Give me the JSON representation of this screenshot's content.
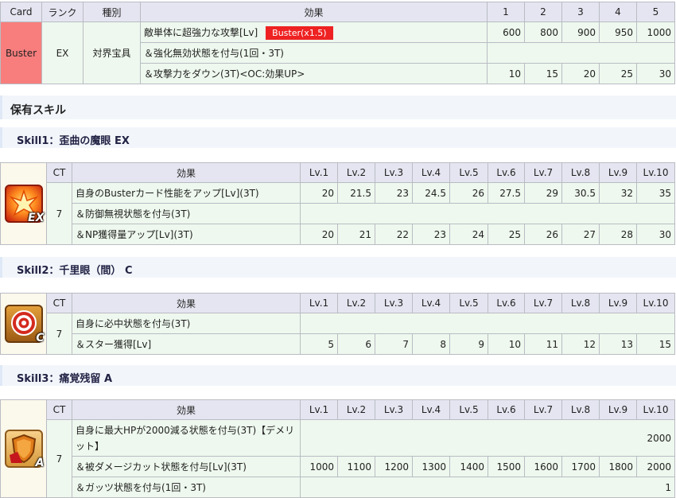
{
  "np": {
    "headers": [
      "Card",
      "ランク",
      "種別",
      "効果",
      "1",
      "2",
      "3",
      "4",
      "5"
    ],
    "card": "Buster",
    "rank": "EX",
    "type": "対界宝具",
    "rows": [
      {
        "effect": "敵単体に超強力な攻撃[Lv]",
        "tag": "Buster(x1.5)",
        "values": [
          "600",
          "800",
          "900",
          "950",
          "1000"
        ]
      },
      {
        "effect": "＆強化無効状態を付与(1回・3T)",
        "values": []
      },
      {
        "effect": "＆攻撃力をダウン(3T)<OC:効果UP>",
        "values": [
          "10",
          "15",
          "20",
          "25",
          "30"
        ]
      }
    ]
  },
  "section_title": "保有スキル",
  "level_headers": [
    "CT",
    "効果",
    "Lv.1",
    "Lv.2",
    "Lv.3",
    "Lv.4",
    "Lv.5",
    "Lv.6",
    "Lv.7",
    "Lv.8",
    "Lv.9",
    "Lv.10"
  ],
  "skills": [
    {
      "title": "Skill1：歪曲の魔眼 EX",
      "icon": "buster-up-icon",
      "rank_label": "EX",
      "ct": "7",
      "rows": [
        {
          "effect": "自身のBusterカード性能をアップ[Lv](3T)",
          "values": [
            "20",
            "21.5",
            "23",
            "24.5",
            "26",
            "27.5",
            "29",
            "30.5",
            "32",
            "35"
          ]
        },
        {
          "effect": "＆防御無視状態を付与(3T)",
          "values": []
        },
        {
          "effect": "＆NP獲得量アップ[Lv](3T)",
          "values": [
            "20",
            "21",
            "22",
            "23",
            "24",
            "25",
            "26",
            "27",
            "28",
            "30"
          ]
        }
      ]
    },
    {
      "title": "Skill2：千里眼（間） C",
      "icon": "target-icon",
      "rank_label": "C",
      "ct": "7",
      "rows": [
        {
          "effect": "自身に必中状態を付与(3T)",
          "values": []
        },
        {
          "effect": "＆スター獲得[Lv]",
          "values": [
            "5",
            "6",
            "7",
            "8",
            "9",
            "10",
            "11",
            "12",
            "13",
            "15"
          ]
        }
      ]
    },
    {
      "title": "Skill3：痛覚残留 A",
      "icon": "shield-icon",
      "rank_label": "A",
      "ct": "7",
      "rows": [
        {
          "effect": "自身に最大HPが2000減る状態を付与(3T)【デメリット】",
          "single": "2000"
        },
        {
          "effect": "＆被ダメージカット状態を付与[Lv](3T)",
          "values": [
            "1000",
            "1100",
            "1200",
            "1300",
            "1400",
            "1500",
            "1600",
            "1700",
            "1800",
            "2000"
          ]
        },
        {
          "effect": "＆ガッツ状態を付与(1回・3T)",
          "single": "1"
        }
      ]
    }
  ]
}
